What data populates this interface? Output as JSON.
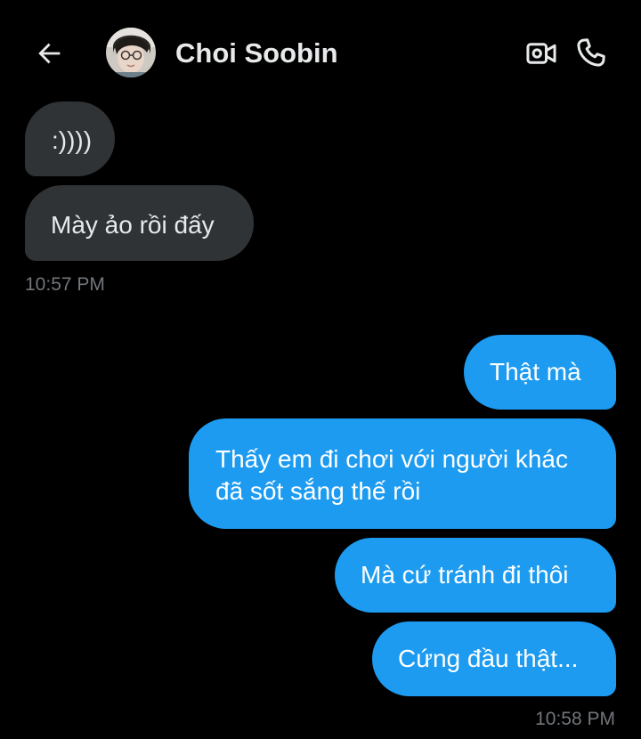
{
  "header": {
    "back_icon": "arrow-left-icon",
    "contact_name": "Choi Soobin",
    "video_icon": "video-camera-icon",
    "call_icon": "phone-icon"
  },
  "colors": {
    "background": "#000000",
    "incoming_bubble": "#2f3336",
    "outgoing_bubble": "#1d9bf0",
    "text_primary": "#e7e9ea",
    "timestamp": "#71767b"
  },
  "messages": [
    {
      "direction": "incoming",
      "text": ":))))"
    },
    {
      "direction": "incoming",
      "text": "Mày ảo rồi đấy"
    },
    {
      "direction": "outgoing",
      "text": "Thật mà"
    },
    {
      "direction": "outgoing",
      "lines": [
        "Thấy em đi chơi với người khác",
        "đã sốt sắng thế rồi"
      ]
    },
    {
      "direction": "outgoing",
      "text": "Mà cứ tránh đi thôi"
    },
    {
      "direction": "outgoing",
      "text": "Cứng đầu thật..."
    }
  ],
  "timestamps": {
    "incoming_group": "10:57 PM",
    "outgoing_group": "10:58 PM"
  }
}
